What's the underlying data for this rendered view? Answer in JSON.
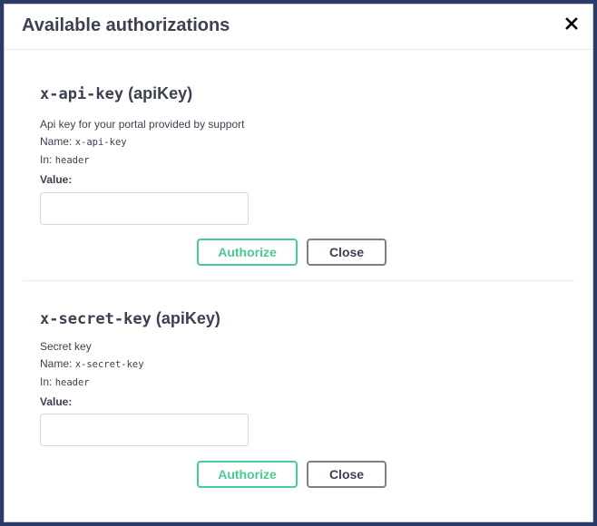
{
  "modal": {
    "title": "Available authorizations",
    "close_icon": "close-x-icon"
  },
  "schemes": [
    {
      "name": "x-api-key",
      "type": "(apiKey)",
      "description": "Api key for your portal provided by support",
      "name_label": "Name:",
      "name_value": "x-api-key",
      "in_label": "In:",
      "in_value": "header",
      "value_label": "Value:",
      "value": "",
      "authorize_label": "Authorize",
      "close_label": "Close"
    },
    {
      "name": "x-secret-key",
      "type": "(apiKey)",
      "description": "Secret key",
      "name_label": "Name:",
      "name_value": "x-secret-key",
      "in_label": "In:",
      "in_value": "header",
      "value_label": "Value:",
      "value": "",
      "authorize_label": "Authorize",
      "close_label": "Close"
    }
  ],
  "colors": {
    "backdrop": "#2b3a67",
    "authorize": "#49cc90",
    "text": "#3b4151"
  }
}
